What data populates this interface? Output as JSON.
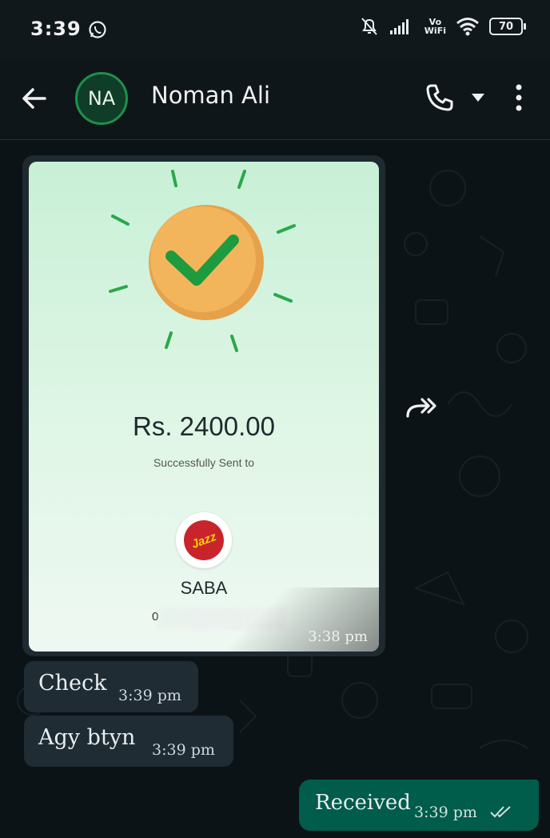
{
  "status_bar": {
    "time": "3:39",
    "network_label_top": "Vo",
    "network_label_bottom": "WiFi",
    "battery": "70",
    "icons": [
      "whatsapp-icon",
      "notifications-off-icon",
      "signal-icon",
      "wifi-icon",
      "battery-icon"
    ]
  },
  "header": {
    "avatar_initials": "NA",
    "contact_name": "Noman Ali",
    "icons": [
      "back-arrow-icon",
      "call-icon",
      "dropdown-icon",
      "more-menu-icon"
    ]
  },
  "receipt": {
    "amount": "Rs. 2400.00",
    "status_text": "Successfully Sent to",
    "logo_text": "Jazz",
    "recipient_name": "SABA",
    "recipient_number": "0",
    "timestamp": "3:38 pm"
  },
  "messages": [
    {
      "direction": "in",
      "text": "Check",
      "time": "3:39 pm"
    },
    {
      "direction": "in",
      "text": "Agy btyn",
      "time": "3:39 pm"
    },
    {
      "direction": "out",
      "text": "Received",
      "time": "3:39 pm",
      "status": "double-check-icon"
    }
  ],
  "colors": {
    "accent_green": "#1f8f4a",
    "outgoing_bubble": "#005c4b",
    "incoming_bubble": "#1f2c34",
    "chat_background": "#0c1317"
  }
}
